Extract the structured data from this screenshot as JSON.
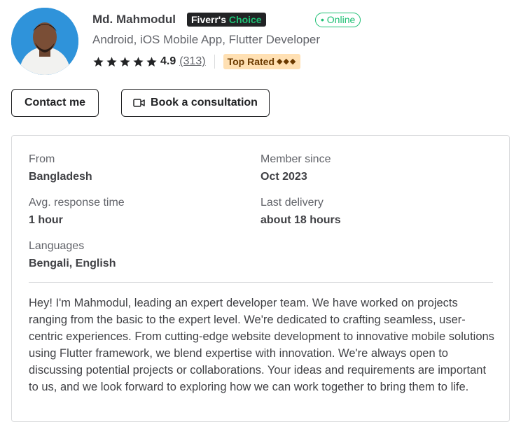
{
  "profile": {
    "name": "Md. Mahmodul",
    "badge_brand": "Fiverr's",
    "badge_choice": "Choice",
    "status": "Online",
    "tagline": "Android, iOS Mobile App, Flutter Developer",
    "rating": "4.9",
    "rating_count": "(313)",
    "stars": 5,
    "level": "Top Rated",
    "level_icons": "◆◆◆"
  },
  "actions": {
    "contact_label": "Contact me",
    "consult_label": "Book a consultation"
  },
  "stats": {
    "from_label": "From",
    "from_value": "Bangladesh",
    "member_label": "Member since",
    "member_value": "Oct 2023",
    "response_label": "Avg. response time",
    "response_value": "1 hour",
    "delivery_label": "Last delivery",
    "delivery_value": "about 18 hours",
    "languages_label": "Languages",
    "languages_value": "Bengali, English"
  },
  "bio": "Hey! I'm Mahmodul, leading an expert developer team. We have worked on projects ranging from the basic to the expert level. We're dedicated to crafting seamless, user-centric experiences. From cutting-edge website development to innovative mobile solutions using Flutter framework, we blend expertise with innovation. We're always open to discussing potential projects or collaborations. Your ideas and requirements are important to us, and we look forward to exploring how we can work together to bring them to life.",
  "colors": {
    "accent_green": "#1dbf73",
    "top_rated_bg": "#ffe0b3",
    "text_dark": "#404145"
  }
}
